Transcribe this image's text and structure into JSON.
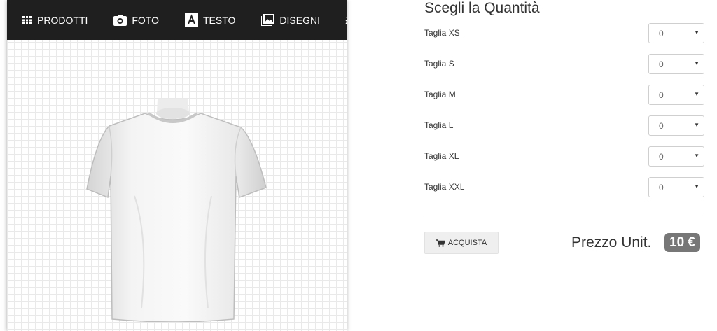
{
  "toolbar": {
    "items": [
      {
        "label": "PRODOTTI",
        "icon": "grid-icon"
      },
      {
        "label": "FOTO",
        "icon": "camera-icon"
      },
      {
        "label": "TESTO",
        "icon": "text-icon"
      },
      {
        "label": "DISEGNI",
        "icon": "image-icon"
      },
      {
        "label": "",
        "icon": "layers-icon"
      }
    ]
  },
  "canvas": {
    "product": "t-shirt"
  },
  "quantity": {
    "title": "Scegli la Quantità",
    "sizes": [
      {
        "label": "Taglia XS",
        "value": "0"
      },
      {
        "label": "Taglia S",
        "value": "0"
      },
      {
        "label": "Taglia M",
        "value": "0"
      },
      {
        "label": "Taglia L",
        "value": "0"
      },
      {
        "label": "Taglia XL",
        "value": "0"
      },
      {
        "label": "Taglia XXL",
        "value": "0"
      }
    ]
  },
  "purchase": {
    "buy_label": "ACQUISTA",
    "price_label": "Prezzo Unit.",
    "price_value": "10 €"
  },
  "colors": {
    "toolbar_bg": "#1f1f1f",
    "badge_bg": "#777777"
  }
}
